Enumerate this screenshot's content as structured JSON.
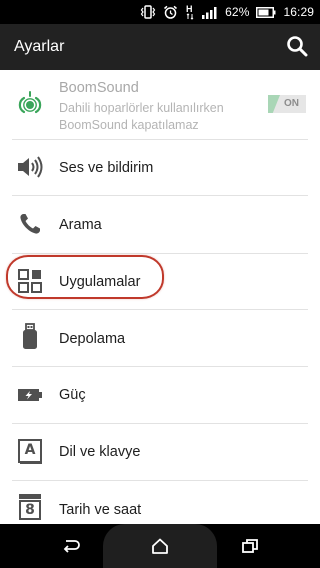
{
  "status_bar": {
    "battery_percent": "62%",
    "time": "16:29",
    "icons": [
      "vibrate-icon",
      "alarm-icon",
      "data-h-icon",
      "signal-icon",
      "battery-icon"
    ]
  },
  "toolbar": {
    "title": "Ayarlar",
    "search_icon": "search-icon"
  },
  "boomsound": {
    "title": "BoomSound",
    "description_line1": "Dahili hoparlörler kullanılırken",
    "description_line2": "BoomSound kapatılamaz",
    "toggle_label": "ON",
    "toggle_on": true,
    "enabled": false
  },
  "settings_items": [
    {
      "label": "Ses ve bildirim",
      "icon": "speaker-icon"
    },
    {
      "label": "Arama",
      "icon": "phone-icon"
    },
    {
      "label": "Uygulamalar",
      "icon": "apps-grid-icon",
      "highlighted": true
    },
    {
      "label": "Depolama",
      "icon": "storage-icon"
    },
    {
      "label": "Güç",
      "icon": "battery-charge-icon"
    },
    {
      "label": "Dil ve klavye",
      "icon": "keyboard-icon"
    },
    {
      "label": "Tarih ve saat",
      "icon": "calendar-icon"
    }
  ],
  "calendar_icon_day": "8",
  "keyboard_icon_letter": "A",
  "nav_bar": {
    "buttons": [
      "back-icon",
      "home-icon",
      "recents-icon"
    ]
  },
  "colors": {
    "toolbar_bg": "#222222",
    "status_bar_bg": "#000000",
    "highlight_ring": "#c0392b",
    "boomsound_icon": "#3aa55a"
  }
}
